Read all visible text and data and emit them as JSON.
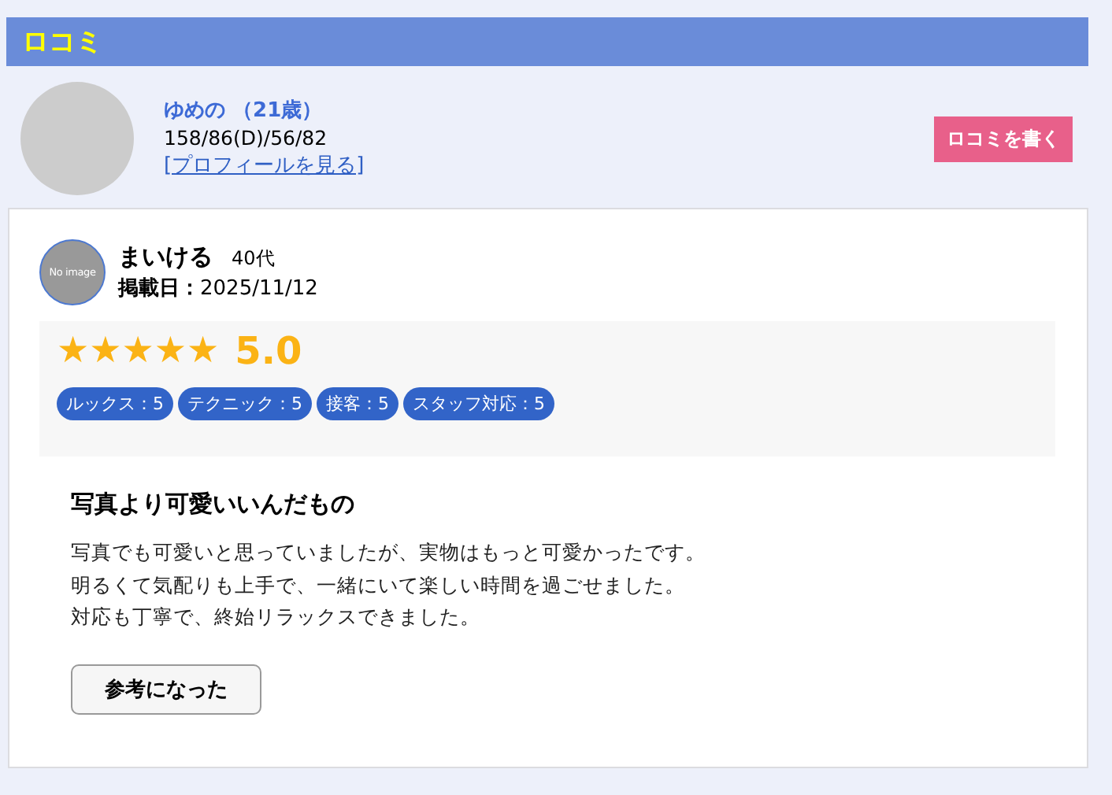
{
  "section": {
    "title": "ロコミ"
  },
  "profile": {
    "name": "ゆめの （21歳）",
    "measurements": "158/86(D)/56/82",
    "profile_link": "[プロフィールを見る]",
    "write_button": "ロコミを書く"
  },
  "review": {
    "avatar_text": "No image",
    "reviewer": "まいける",
    "age": "40代",
    "date_label": "掲載日：",
    "date": "2025/11/12",
    "stars": 5,
    "score": "5.0",
    "ratings": [
      {
        "label": "ルックス：5"
      },
      {
        "label": "テクニック：5"
      },
      {
        "label": "接客：5"
      },
      {
        "label": "スタッフ対応：5"
      }
    ],
    "title": "写真より可愛いいんだもの",
    "body": [
      "写真でも可愛いと思っていましたが、実物はもっと可愛かったです。",
      "明るくて気配りも上手で、一緒にいて楽しい時間を過ごせました。",
      "対応も丁寧で、終始リラックスできました。"
    ],
    "helpful_button": "参考になった"
  }
}
